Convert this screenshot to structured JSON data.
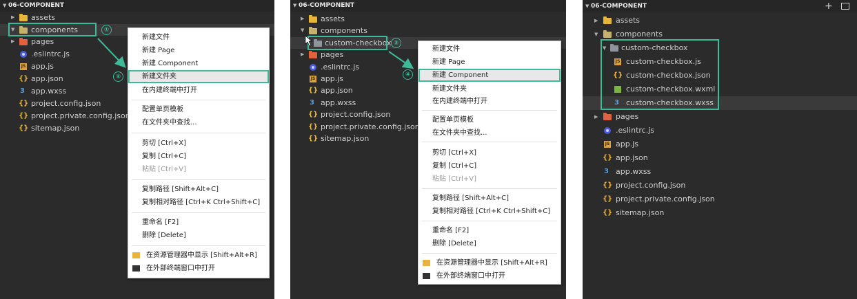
{
  "colors": {
    "accent": "#3dba98",
    "panel_bg": "#2b2b2b",
    "menu_bg": "#ffffff"
  },
  "panel1": {
    "title": "06-COMPONENT",
    "tree": [
      {
        "label": "assets",
        "icon": "folder-icon"
      },
      {
        "label": "components",
        "icon": "components-folder-icon"
      },
      {
        "label": "pages",
        "icon": "pages-folder-icon"
      },
      {
        "label": ".eslintrc.js",
        "icon": "eslint-icon"
      },
      {
        "label": "app.js",
        "icon": "js-icon"
      },
      {
        "label": "app.json",
        "icon": "json-icon"
      },
      {
        "label": "app.wxss",
        "icon": "wxss-icon"
      },
      {
        "label": "project.config.json",
        "icon": "json-icon"
      },
      {
        "label": "project.private.config.json",
        "icon": "json-icon"
      },
      {
        "label": "sitemap.json",
        "icon": "json-icon"
      }
    ],
    "step_badges": [
      "①",
      "②"
    ],
    "menu": [
      "新建文件",
      "新建 Page",
      "新建 Component",
      "新建文件夹",
      "在内建终端中打开",
      "配置单页模板",
      "在文件夹中查找...",
      "剪切  [Ctrl+X]",
      "复制  [Ctrl+C]",
      "粘贴  [Ctrl+V]",
      "复制路径  [Shift+Alt+C]",
      "复制相对路径  [Ctrl+K Ctrl+Shift+C]",
      "重命名  [F2]",
      "删除  [Delete]",
      "在资源管理器中显示  [Shift+Alt+R]",
      "在外部终端窗口中打开"
    ]
  },
  "panel2": {
    "title": "06-COMPONENT",
    "tree": [
      {
        "label": "assets",
        "icon": "folder-icon"
      },
      {
        "label": "components",
        "icon": "components-folder-icon"
      },
      {
        "label": "custom-checkbox",
        "icon": "gray-folder-icon"
      },
      {
        "label": "pages",
        "icon": "pages-folder-icon"
      },
      {
        "label": ".eslintrc.js",
        "icon": "eslint-icon"
      },
      {
        "label": "app.js",
        "icon": "js-icon"
      },
      {
        "label": "app.json",
        "icon": "json-icon"
      },
      {
        "label": "app.wxss",
        "icon": "wxss-icon"
      },
      {
        "label": "project.config.json",
        "icon": "json-icon"
      },
      {
        "label": "project.private.config.json",
        "icon": "json-icon"
      },
      {
        "label": "sitemap.json",
        "icon": "json-icon"
      }
    ],
    "step_badges": [
      "③",
      "④"
    ],
    "menu": [
      "新建文件",
      "新建 Page",
      "新建 Component",
      "新建文件夹",
      "在内建终端中打开",
      "配置单页模板",
      "在文件夹中查找...",
      "剪切  [Ctrl+X]",
      "复制  [Ctrl+C]",
      "粘贴  [Ctrl+V]",
      "复制路径  [Shift+Alt+C]",
      "复制相对路径  [Ctrl+K Ctrl+Shift+C]",
      "重命名  [F2]",
      "删除  [Delete]",
      "在资源管理器中显示  [Shift+Alt+R]",
      "在外部终端窗口中打开"
    ]
  },
  "panel3": {
    "title": "06-COMPONENT",
    "tree": [
      {
        "label": "assets",
        "icon": "folder-icon"
      },
      {
        "label": "components",
        "icon": "components-folder-icon"
      },
      {
        "label": "custom-checkbox",
        "icon": "gray-folder-icon"
      },
      {
        "label": "custom-checkbox.js",
        "icon": "js-icon"
      },
      {
        "label": "custom-checkbox.json",
        "icon": "json-icon"
      },
      {
        "label": "custom-checkbox.wxml",
        "icon": "wxml-icon"
      },
      {
        "label": "custom-checkbox.wxss",
        "icon": "wxss-icon"
      },
      {
        "label": "pages",
        "icon": "pages-folder-icon"
      },
      {
        "label": ".eslintrc.js",
        "icon": "eslint-icon"
      },
      {
        "label": "app.js",
        "icon": "js-icon"
      },
      {
        "label": "app.json",
        "icon": "json-icon"
      },
      {
        "label": "app.wxss",
        "icon": "wxss-icon"
      },
      {
        "label": "project.config.json",
        "icon": "json-icon"
      },
      {
        "label": "project.private.config.json",
        "icon": "json-icon"
      },
      {
        "label": "sitemap.json",
        "icon": "json-icon"
      }
    ],
    "toolbar": {
      "new_file": "+",
      "new_folder": "+"
    }
  }
}
